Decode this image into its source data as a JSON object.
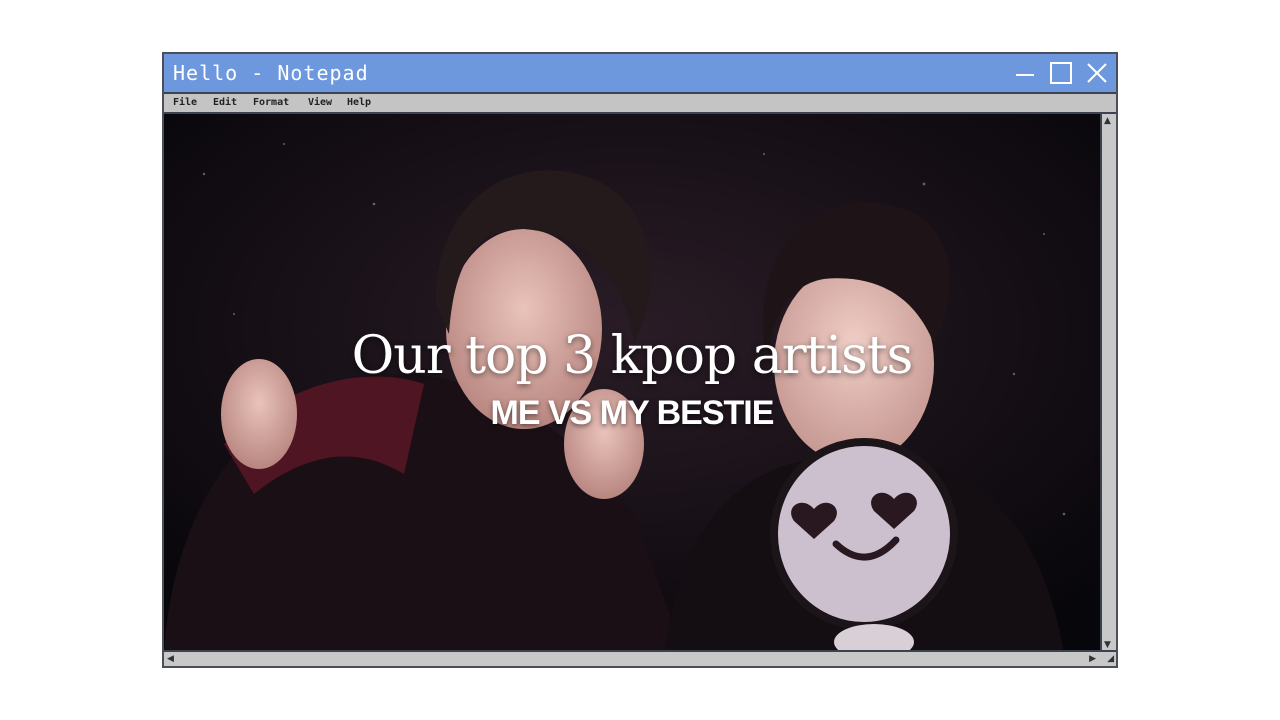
{
  "window": {
    "title": "Hello - Notepad",
    "titlebar_color": "#6e98de",
    "controls": [
      "minimize-icon",
      "maximize-icon",
      "close-icon"
    ]
  },
  "menu": {
    "items": [
      {
        "label": "File"
      },
      {
        "label": "Edit"
      },
      {
        "label": "Format"
      },
      {
        "label": "View"
      },
      {
        "label": "Help"
      }
    ]
  },
  "content": {
    "headline": "Our top 3 kpop artists",
    "subheadline": "ME VS MY BESTIE",
    "image": "concert-photo-two-performers-with-heart-eyes-fan-sign"
  }
}
